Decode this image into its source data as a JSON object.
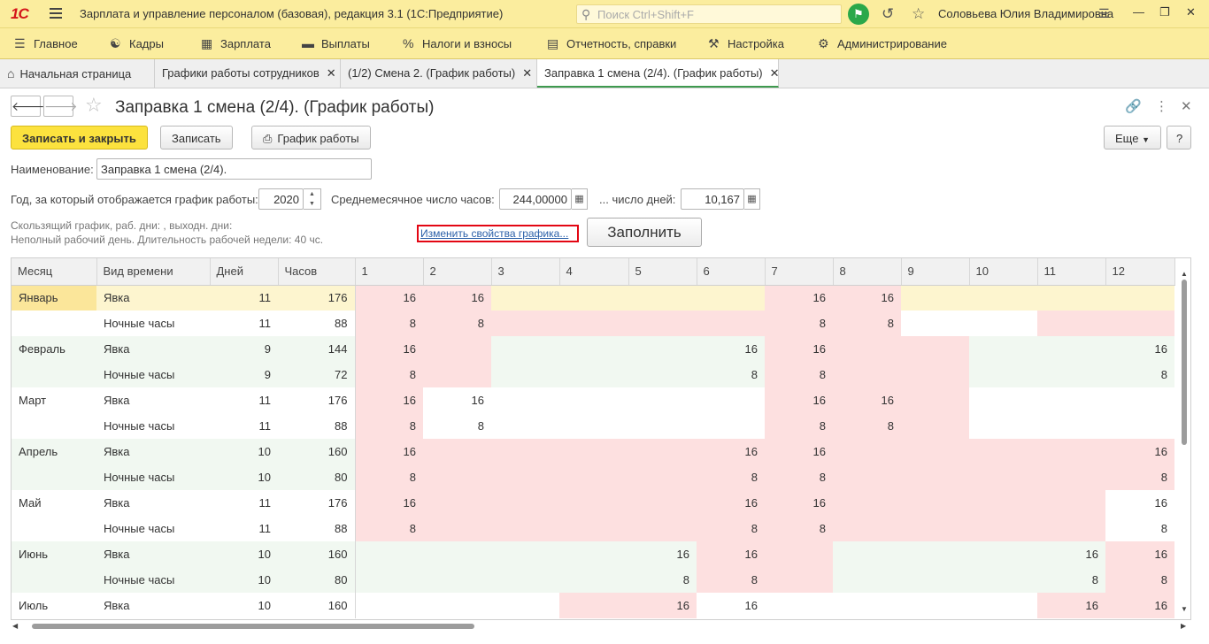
{
  "app": {
    "logo": "1С",
    "title": "Зарплата и управление персоналом (базовая), редакция 3.1  (1С:Предприятие)",
    "search_placeholder": "Поиск Ctrl+Shift+F",
    "user": "Соловьева Юлия Владимировна"
  },
  "menu": [
    {
      "label": "Главное",
      "icon": "menu-lines-icon"
    },
    {
      "label": "Кадры",
      "icon": "people-icon"
    },
    {
      "label": "Зарплата",
      "icon": "calculator-icon"
    },
    {
      "label": "Выплаты",
      "icon": "wallet-icon"
    },
    {
      "label": "Налоги и взносы",
      "icon": "percent-icon"
    },
    {
      "label": "Отчетность, справки",
      "icon": "document-icon"
    },
    {
      "label": "Настройка",
      "icon": "wrench-icon"
    },
    {
      "label": "Администрирование",
      "icon": "gear-icon"
    }
  ],
  "tabs": [
    {
      "label": "Начальная страница"
    },
    {
      "label": "Графики работы сотрудников"
    },
    {
      "label": "(1/2)  Смена 2. (График работы)"
    },
    {
      "label": "Заправка 1 смена (2/4). (График работы)"
    }
  ],
  "form": {
    "title": "Заправка 1 смена (2/4). (График работы)",
    "save_close": "Записать и закрыть",
    "save": "Записать",
    "schedule": "График работы",
    "more": "Еще",
    "help": "?",
    "name_label": "Наименование:",
    "name_value": "Заправка 1 смена (2/4).",
    "year_label": "Год, за который отображается график работы:",
    "year_value": "2020",
    "avg_hours_label": "Среднемесячное число часов:",
    "avg_hours_value": "244,00000",
    "days_label": "... число дней:",
    "days_value": "10,167",
    "note1": "Скользящий график, раб. дни: , выходн. дни:",
    "note2": "Неполный рабочий день. Длительность рабочей недели: 40 чс.",
    "change_link": "Изменить свойства графика...",
    "fill_button": "Заполнить"
  },
  "grid": {
    "columns": [
      "Месяц",
      "Вид времени",
      "Дней",
      "Часов",
      "1",
      "2",
      "3",
      "4",
      "5",
      "6",
      "7",
      "8",
      "9",
      "10",
      "11",
      "12"
    ],
    "rows": [
      {
        "month": "Январь",
        "kind": "Явка",
        "days": "11",
        "hours": "176",
        "cells": [
          "16",
          "16",
          "",
          "",
          "",
          "",
          "16",
          "16",
          "",
          "",
          "",
          ""
        ],
        "pink": [
          1,
          1,
          0,
          0,
          0,
          0,
          1,
          1,
          0,
          0,
          0,
          0
        ]
      },
      {
        "month": "",
        "kind": "Ночные часы",
        "days": "11",
        "hours": "88",
        "cells": [
          "8",
          "8",
          "",
          "",
          "",
          "",
          "8",
          "8",
          "",
          "",
          "",
          ""
        ],
        "pink": [
          1,
          1,
          1,
          1,
          1,
          1,
          1,
          1,
          0,
          0,
          1,
          1
        ]
      },
      {
        "month": "Февраль",
        "kind": "Явка",
        "days": "9",
        "hours": "144",
        "cells": [
          "16",
          "",
          "",
          "",
          "",
          "16",
          "16",
          "",
          "",
          "",
          "",
          "16"
        ],
        "pink": [
          1,
          1,
          0,
          0,
          0,
          0,
          1,
          1,
          1,
          0,
          0,
          0
        ]
      },
      {
        "month": "",
        "kind": "Ночные часы",
        "days": "9",
        "hours": "72",
        "cells": [
          "8",
          "",
          "",
          "",
          "",
          "8",
          "8",
          "",
          "",
          "",
          "",
          "8"
        ],
        "pink": [
          1,
          1,
          0,
          0,
          0,
          0,
          1,
          1,
          1,
          0,
          0,
          0
        ]
      },
      {
        "month": "Март",
        "kind": "Явка",
        "days": "11",
        "hours": "176",
        "cells": [
          "16",
          "16",
          "",
          "",
          "",
          "",
          "16",
          "16",
          "",
          "",
          "",
          ""
        ],
        "pink": [
          1,
          0,
          0,
          0,
          0,
          0,
          1,
          1,
          1,
          0,
          0,
          0
        ]
      },
      {
        "month": "",
        "kind": "Ночные часы",
        "days": "11",
        "hours": "88",
        "cells": [
          "8",
          "8",
          "",
          "",
          "",
          "",
          "8",
          "8",
          "",
          "",
          "",
          ""
        ],
        "pink": [
          1,
          0,
          0,
          0,
          0,
          0,
          1,
          1,
          1,
          0,
          0,
          0
        ]
      },
      {
        "month": "Апрель",
        "kind": "Явка",
        "days": "10",
        "hours": "160",
        "cells": [
          "16",
          "",
          "",
          "",
          "",
          "16",
          "16",
          "",
          "",
          "",
          "",
          "16"
        ],
        "pink": [
          1,
          1,
          1,
          1,
          1,
          1,
          1,
          1,
          1,
          1,
          1,
          1
        ]
      },
      {
        "month": "",
        "kind": "Ночные часы",
        "days": "10",
        "hours": "80",
        "cells": [
          "8",
          "",
          "",
          "",
          "",
          "8",
          "8",
          "",
          "",
          "",
          "",
          "8"
        ],
        "pink": [
          1,
          1,
          1,
          1,
          1,
          1,
          1,
          1,
          1,
          1,
          1,
          1
        ]
      },
      {
        "month": "Май",
        "kind": "Явка",
        "days": "11",
        "hours": "176",
        "cells": [
          "16",
          "",
          "",
          "",
          "",
          "16",
          "16",
          "",
          "",
          "",
          "",
          "16"
        ],
        "pink": [
          1,
          1,
          1,
          1,
          1,
          1,
          1,
          1,
          1,
          1,
          1,
          0
        ]
      },
      {
        "month": "",
        "kind": "Ночные часы",
        "days": "11",
        "hours": "88",
        "cells": [
          "8",
          "",
          "",
          "",
          "",
          "8",
          "8",
          "",
          "",
          "",
          "",
          "8"
        ],
        "pink": [
          1,
          1,
          1,
          1,
          1,
          1,
          1,
          1,
          1,
          1,
          1,
          0
        ]
      },
      {
        "month": "Июнь",
        "kind": "Явка",
        "days": "10",
        "hours": "160",
        "cells": [
          "",
          "",
          "",
          "",
          "16",
          "16",
          "",
          "",
          "",
          "",
          "16",
          "16"
        ],
        "pink": [
          0,
          0,
          0,
          0,
          0,
          1,
          1,
          0,
          0,
          0,
          0,
          1
        ]
      },
      {
        "month": "",
        "kind": "Ночные часы",
        "days": "10",
        "hours": "80",
        "cells": [
          "",
          "",
          "",
          "",
          "8",
          "8",
          "",
          "",
          "",
          "",
          "8",
          "8"
        ],
        "pink": [
          0,
          0,
          0,
          0,
          0,
          1,
          1,
          0,
          0,
          0,
          0,
          1
        ]
      },
      {
        "month": "Июль",
        "kind": "Явка",
        "days": "10",
        "hours": "160",
        "cells": [
          "",
          "",
          "",
          "",
          "16",
          "16",
          "",
          "",
          "",
          "",
          "16",
          "16"
        ],
        "pink": [
          0,
          0,
          0,
          1,
          1,
          0,
          0,
          0,
          0,
          0,
          1,
          1
        ]
      }
    ]
  },
  "colors": {
    "accent_yellow": "#fbed9e",
    "pink_cell": "#fde0e0",
    "green_band": "#f1f8f1",
    "selected_row": "#fdf5cf",
    "selected_cell": "#fbe69a",
    "link_frame": "#e30613"
  }
}
